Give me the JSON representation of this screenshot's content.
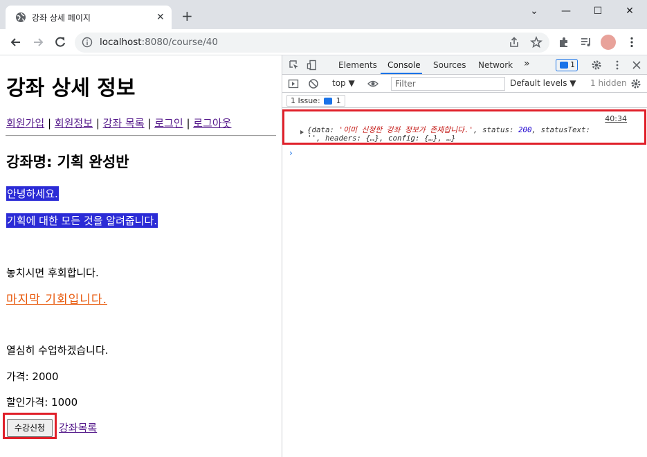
{
  "browser": {
    "tab_title": "강좌 상세 페이지",
    "url_host": "localhost",
    "url_path": ":8080/course/40",
    "new_tab_symbol": "+",
    "tab_close_symbol": "✕",
    "minimize_symbol": "—",
    "maximize_symbol": "☐",
    "close_symbol": "✕",
    "chevron_symbol": "⌄"
  },
  "page": {
    "heading": "강좌 상세 정보",
    "nav_links": [
      "회원가입",
      "회원정보",
      "강좌 목록",
      "로그인",
      "로그아웃"
    ],
    "nav_separator": "|",
    "course_name": "강좌명: 기획 완성반",
    "desc_line1": "안녕하세요.",
    "desc_line2": "기획에 대한 모든 것을 알려줍니다.",
    "desc_line3": "놓치시면 후회합니다.",
    "highlight_line": "마지막 기회입니다.",
    "desc_line4": "열심히 수업하겠습니다.",
    "price": "가격: 2000",
    "discount_price": "할인가격: 1000",
    "enroll_button": "수강신청",
    "course_list_link": "강좌목록"
  },
  "devtools": {
    "tabs": [
      "Elements",
      "Console",
      "Sources",
      "Network"
    ],
    "more_tabs": "»",
    "active_tab": "Console",
    "badge_count": "1",
    "context": "top",
    "filter_placeholder": "Filter",
    "levels": "Default levels",
    "hidden": "1 hidden",
    "issues_label": "1 Issue:",
    "issues_count": "1",
    "log": {
      "source": "40:34",
      "line1_prefix": "{data: ",
      "data_value": "'이미 신청한 강좌 정보가 존재합니다.'",
      "line1_mid": ", status: ",
      "status_value": "200",
      "line1_suffix": ", statusText:",
      "line2": "'', headers: {…}, config: {…}, …}"
    },
    "prompt": "›"
  },
  "colors": {
    "highlight_bg": "#2b2bd6",
    "orange_text": "#e8590c",
    "annotation_red": "#e0202a",
    "link_visited": "#551a8b",
    "devtools_accent": "#1a73e8"
  }
}
